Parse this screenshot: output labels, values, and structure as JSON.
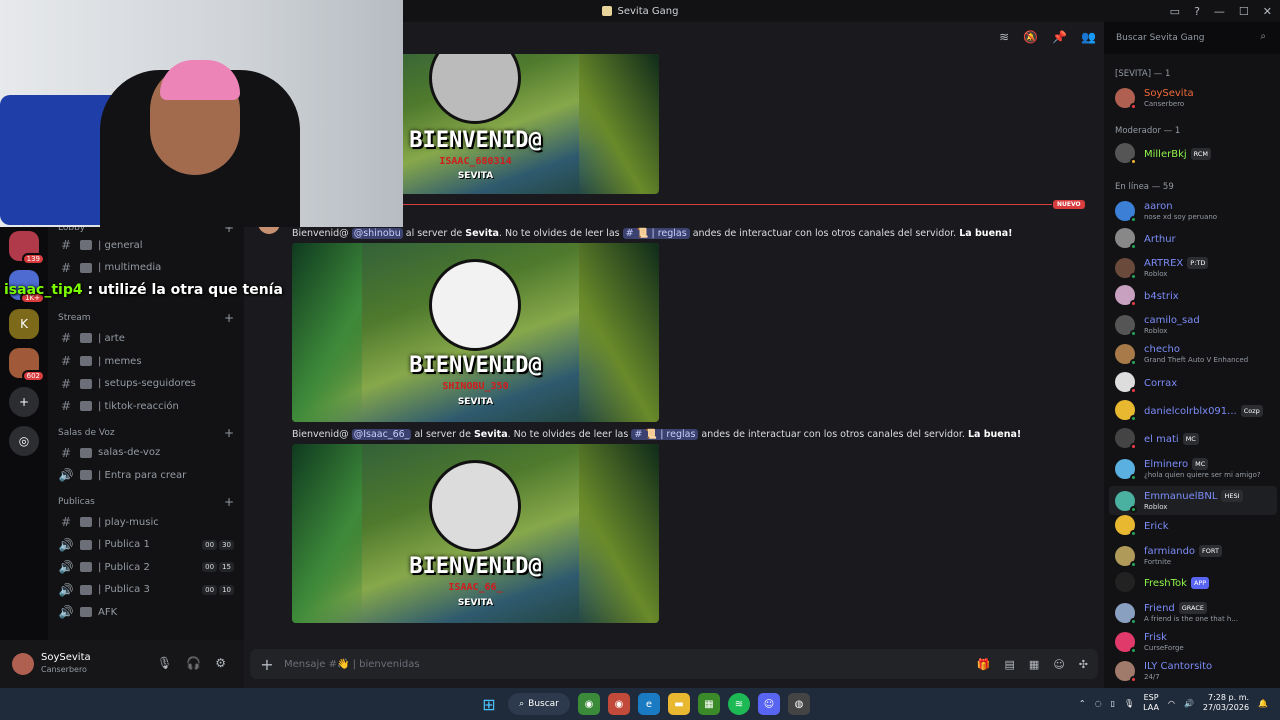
{
  "window": {
    "title": "Sevita Gang"
  },
  "search": {
    "placeholder": "Buscar Sevita Gang"
  },
  "stream_overlay": {
    "username": "isaac_tip4",
    "message": ": utilizé la otra que tenía"
  },
  "servers": {
    "badges": [
      "139",
      "1K+",
      "602"
    ]
  },
  "channels": {
    "lobby": {
      "label": "Lobby"
    },
    "lobby_items": [
      {
        "label": "| general"
      },
      {
        "label": "| multimedia"
      }
    ],
    "stream": {
      "label": "Stream"
    },
    "stream_items": [
      {
        "label": "| arte"
      },
      {
        "label": "| memes"
      },
      {
        "label": "| setups-seguidores"
      },
      {
        "label": "| tiktok-reacción"
      }
    ],
    "voice": {
      "label": "Salas de Voz"
    },
    "voice_items": [
      {
        "label": "salas-de-voz"
      },
      {
        "label": "| Entra para crear"
      }
    ],
    "publicas": {
      "label": "Publicas"
    },
    "publicas_items": [
      {
        "label": "| play-music"
      },
      {
        "label": "| Publica 1",
        "a": "00",
        "b": "30"
      },
      {
        "label": "| Publica 2",
        "a": "00",
        "b": "15"
      },
      {
        "label": "| Publica 3",
        "a": "00",
        "b": "10"
      },
      {
        "label": "AFK"
      }
    ]
  },
  "user": {
    "name": "SoySevita",
    "status": "Canserbero"
  },
  "chat": {
    "new_label": "NUEVO",
    "banners": [
      {
        "welcome": "BIENVENID@",
        "user": "ISAAC_680314",
        "brand": "SEVITA"
      },
      {
        "welcome": "BIENVENID@",
        "user": "SHINOBU_350",
        "brand": "SEVITA"
      },
      {
        "welcome": "BIENVENID@",
        "user": "ISAAC_66_",
        "brand": "SEVITA"
      }
    ],
    "messages": [
      {
        "prefix": "Bienvenid@",
        "mention": "@shinobu",
        "mid": "al server de",
        "server": "Sevita",
        "mid2": ". No te olvides de leer las",
        "channel": "# 📜 | reglas",
        "suffix": "andes de interactuar con los otros canales del servidor.",
        "bold": "La buena!"
      },
      {
        "prefix": "Bienvenid@",
        "mention": "@Isaac_66_",
        "mid": "al server de",
        "server": "Sevita",
        "mid2": ". No te olvides de leer las",
        "channel": "# 📜 | reglas",
        "suffix": "andes de interactuar con los otros canales del servidor.",
        "bold": "La buena!"
      }
    ],
    "composer_placeholder": "Mensaje #👋 | bienvenidas"
  },
  "members": {
    "cat_sevita": "[SEVITA] — 1",
    "cat_mod": "Moderador — 1",
    "cat_online": "En línea — 59",
    "list": [
      {
        "name": "SoySevita",
        "activity": "Canserbero"
      },
      {
        "name": "MillerBkj",
        "tag": "RCM"
      },
      {
        "name": "aaron",
        "activity": "nose xd soy peruano"
      },
      {
        "name": "Arthur"
      },
      {
        "name": "ARTREX",
        "tag": "P:TD",
        "activity": "Roblox"
      },
      {
        "name": "b4strix"
      },
      {
        "name": "camilo_sad",
        "activity": "Roblox"
      },
      {
        "name": "checho",
        "activity": "Grand Theft Auto V Enhanced"
      },
      {
        "name": "Corrax"
      },
      {
        "name": "danielcolrblx091...",
        "tag": "Cozp"
      },
      {
        "name": "el mati",
        "tag": "MC"
      },
      {
        "name": "Elminero",
        "tag": "MC",
        "activity": "¿hola quien quiere ser mi amigo?"
      },
      {
        "name": "EmmanuelBNL",
        "tag": "HESI",
        "activity": "Roblox"
      },
      {
        "name": "Erick"
      },
      {
        "name": "farmiando",
        "tag": "FORT",
        "activity": "Fortnite"
      },
      {
        "name": "FreshTok",
        "tag": "APP"
      },
      {
        "name": "Friend",
        "tag": "GRACE",
        "activity": "A friend is the one that h..."
      },
      {
        "name": "Frisk",
        "activity": "CurseForge"
      },
      {
        "name": "ILY Cantorsito",
        "activity": "24/7"
      }
    ]
  },
  "taskbar": {
    "search": "Buscar",
    "lang1": "ESP",
    "lang2": "LAA",
    "time": "7:28 p. m.",
    "date": "27/03/2026"
  }
}
